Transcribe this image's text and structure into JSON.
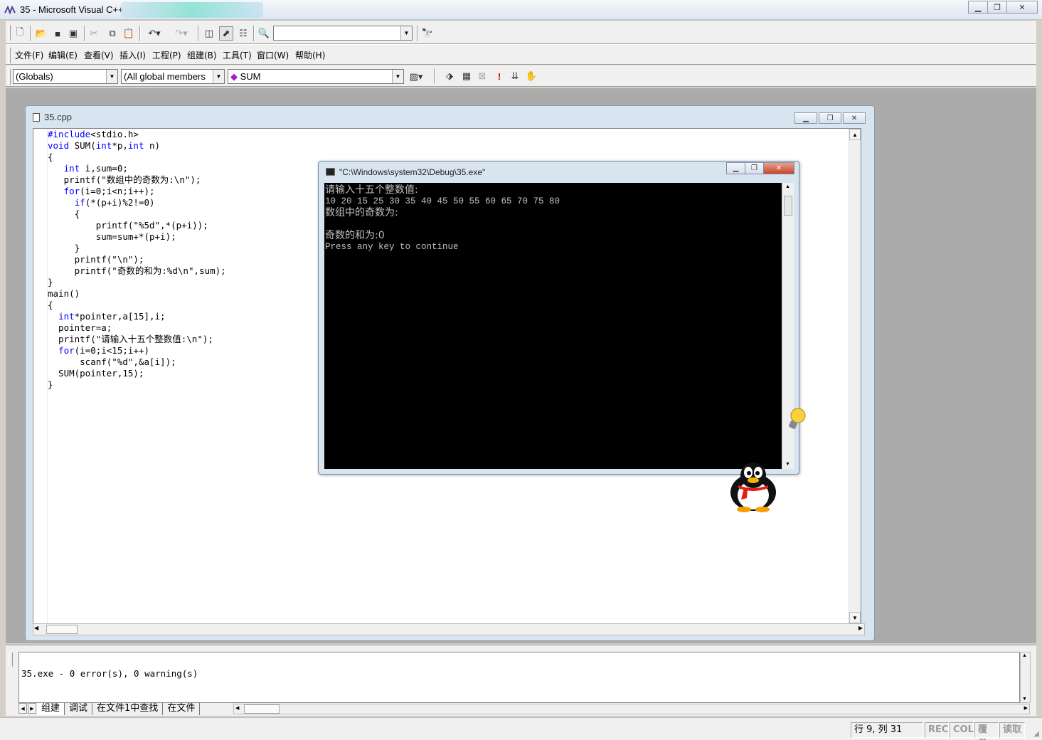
{
  "window": {
    "title": "35 - Microsoft Visual C++"
  },
  "toolbar": {
    "find_combo_value": ""
  },
  "menu": {
    "items": [
      "文件(F)",
      "编辑(E)",
      "查看(V)",
      "插入(I)",
      "工程(P)",
      "组建(B)",
      "工具(T)",
      "窗口(W)",
      "帮助(H)"
    ]
  },
  "wizardbar": {
    "scope": "(Globals)",
    "members": "(All global members",
    "function": "SUM"
  },
  "editor": {
    "file_title": "35.cpp",
    "lines": [
      [
        {
          "k": 1,
          "t": "#include"
        },
        {
          "t": "<stdio.h>"
        }
      ],
      [
        {
          "k": 1,
          "t": "void"
        },
        {
          "t": " SUM("
        },
        {
          "k": 1,
          "t": "int"
        },
        {
          "t": "*p,"
        },
        {
          "k": 1,
          "t": "int"
        },
        {
          "t": " n)"
        }
      ],
      [
        {
          "t": "{"
        }
      ],
      [
        {
          "t": "   "
        },
        {
          "k": 1,
          "t": "int"
        },
        {
          "t": " i,sum=0;"
        }
      ],
      [
        {
          "t": "   printf(\"数组中的奇数为:\\n\");"
        }
      ],
      [
        {
          "t": "   "
        },
        {
          "k": 1,
          "t": "for"
        },
        {
          "t": "(i=0;i<n;i++);"
        }
      ],
      [
        {
          "t": "     "
        },
        {
          "k": 1,
          "t": "if"
        },
        {
          "t": "(*(p+i)%2!=0)"
        }
      ],
      [
        {
          "t": "     {"
        }
      ],
      [
        {
          "t": "         printf(\"%5d\",*(p+i));"
        }
      ],
      [
        {
          "t": "         sum=sum+*(p+i);"
        }
      ],
      [
        {
          "t": "     }"
        }
      ],
      [
        {
          "t": "     printf(\"\\n\");"
        }
      ],
      [
        {
          "t": "     printf(\"奇数的和为:%d\\n\",sum);"
        }
      ],
      [
        {
          "t": "}"
        }
      ],
      [
        {
          "t": "main()"
        }
      ],
      [
        {
          "t": "{"
        }
      ],
      [
        {
          "t": "  "
        },
        {
          "k": 1,
          "t": "int"
        },
        {
          "t": "*pointer,a[15],i;"
        }
      ],
      [
        {
          "t": "  pointer=a;"
        }
      ],
      [
        {
          "t": "  printf(\"请输入十五个整数值:\\n\");"
        }
      ],
      [
        {
          "t": "  "
        },
        {
          "k": 1,
          "t": "for"
        },
        {
          "t": "(i=0;i<15;i++)"
        }
      ],
      [
        {
          "t": "      scanf(\"%d\",&a[i]);"
        }
      ],
      [
        {
          "t": "  SUM(pointer,15);"
        }
      ],
      [
        {
          "t": "}"
        }
      ]
    ]
  },
  "console": {
    "title": "\"C:\\Windows\\system32\\Debug\\35.exe\"",
    "lines": [
      {
        "t": "请输入十五个整数值:",
        "c": "cn"
      },
      {
        "t": "10 20 15 25 30 35 40 45 50 55 60 65 70 75 80",
        "c": "small"
      },
      {
        "t": "数组中的奇数为:",
        "c": "cn"
      },
      {
        "t": "",
        "c": ""
      },
      {
        "t": "奇数的和为:0",
        "c": "cn"
      },
      {
        "t": "Press any key to continue",
        "c": "small"
      }
    ]
  },
  "output": {
    "text": "35.exe - 0 error(s), 0 warning(s)",
    "tabs": [
      "组建",
      "调试",
      "在文件1中查找",
      "在文件"
    ]
  },
  "status": {
    "position": "行 9, 列 31",
    "rec": "REC",
    "col": "COL",
    "ovr": "覆盖",
    "read": "读取"
  },
  "colors": {
    "keyword": "#0000ff",
    "console_bg": "#000000",
    "console_fg": "#c0c0c0"
  }
}
